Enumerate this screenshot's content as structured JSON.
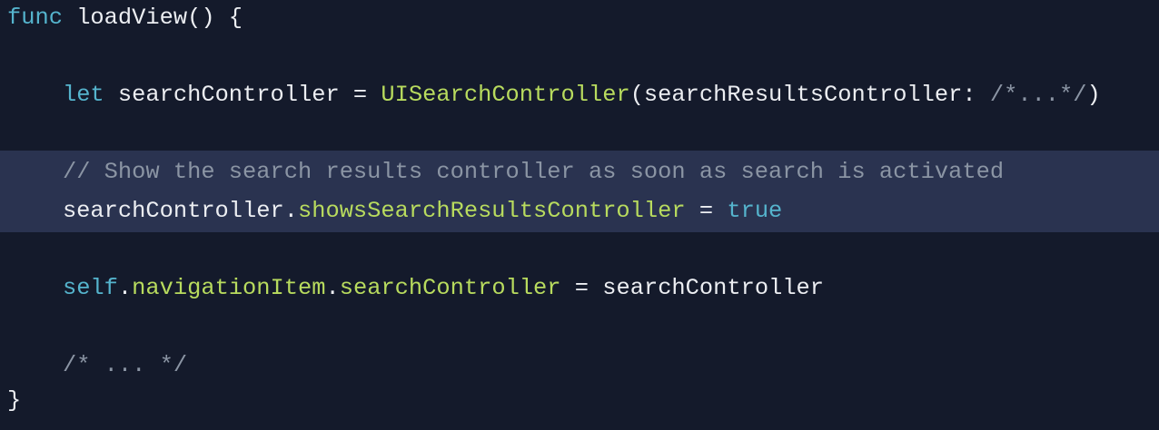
{
  "colors": {
    "background": "#141a2b",
    "highlight": "#2a3350",
    "keyword": "#55b4cd",
    "identifier": "#b8db5e",
    "comment": "#8b95a4",
    "text": "#eceef2"
  },
  "lines": [
    [
      {
        "t": "kw",
        "v": "func"
      },
      {
        "t": "plain",
        "v": " loadView() {"
      }
    ],
    [],
    [
      {
        "t": "plain",
        "v": "    "
      },
      {
        "t": "kw",
        "v": "let"
      },
      {
        "t": "plain",
        "v": " searchController = "
      },
      {
        "t": "fn",
        "v": "UISearchController"
      },
      {
        "t": "plain",
        "v": "(searchResultsController: "
      },
      {
        "t": "cm",
        "v": "/*...*/"
      },
      {
        "t": "plain",
        "v": ")"
      }
    ],
    [],
    [
      {
        "t": "plain",
        "v": "    "
      },
      {
        "t": "cm",
        "v": "// Show the search results controller as soon as search is activated"
      }
    ],
    [
      {
        "t": "plain",
        "v": "    searchController."
      },
      {
        "t": "fn",
        "v": "showsSearchResultsController"
      },
      {
        "t": "plain",
        "v": " = "
      },
      {
        "t": "kw",
        "v": "true"
      }
    ],
    [],
    [
      {
        "t": "plain",
        "v": "    "
      },
      {
        "t": "kw",
        "v": "self"
      },
      {
        "t": "plain",
        "v": "."
      },
      {
        "t": "fn",
        "v": "navigationItem"
      },
      {
        "t": "plain",
        "v": "."
      },
      {
        "t": "fn",
        "v": "searchController"
      },
      {
        "t": "plain",
        "v": " = searchController"
      }
    ],
    [],
    [
      {
        "t": "plain",
        "v": "    "
      },
      {
        "t": "cm",
        "v": "/* ... */"
      }
    ],
    [
      {
        "t": "plain",
        "v": "}"
      }
    ]
  ]
}
